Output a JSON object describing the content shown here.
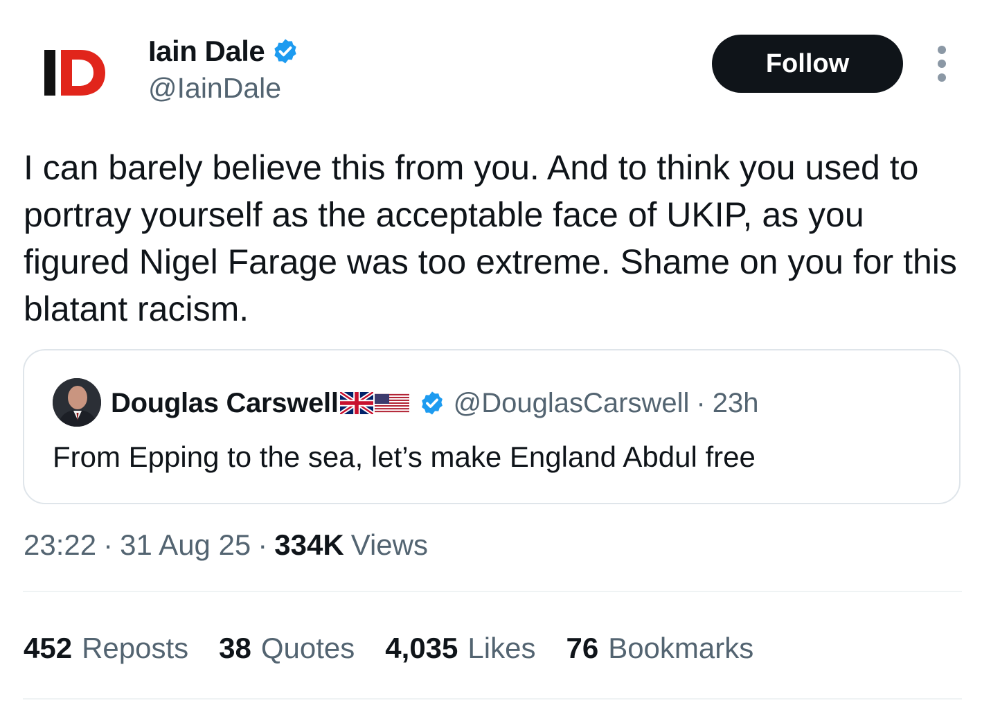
{
  "author": {
    "avatar_text": "ID",
    "display_name": "Iain Dale",
    "handle": "@IainDale",
    "verified": true,
    "verified_icon": "verified-badge-icon"
  },
  "actions": {
    "follow_label": "Follow",
    "more_icon": "more-vertical-icon"
  },
  "tweet": {
    "text": "I can barely believe this from you. And to think you used to portray yourself as the acceptable face of UKIP, as you figured Nigel Farage was too extreme. Shame on you for this blatant racism."
  },
  "quote": {
    "display_name": "Douglas Carswell",
    "flags": [
      "uk-flag-icon",
      "us-flag-icon"
    ],
    "verified": true,
    "handle": "@DouglasCarswell",
    "separator": "·",
    "time": "23h",
    "text": "From Epping to the sea, let’s make England Abdul free"
  },
  "meta": {
    "time": "23:22",
    "separator": "·",
    "date": "31 Aug 25",
    "views_count": "334K",
    "views_label": "Views"
  },
  "stats": [
    {
      "count": "452",
      "label": "Reposts"
    },
    {
      "count": "38",
      "label": "Quotes"
    },
    {
      "count": "4,035",
      "label": "Likes"
    },
    {
      "count": "76",
      "label": "Bookmarks"
    }
  ],
  "colors": {
    "text_primary": "#0f1419",
    "text_secondary": "#536471",
    "verified_blue": "#1d9bf0",
    "logo_red": "#e1251b",
    "button_bg": "#0f1419",
    "border": "#dfe5ea"
  }
}
